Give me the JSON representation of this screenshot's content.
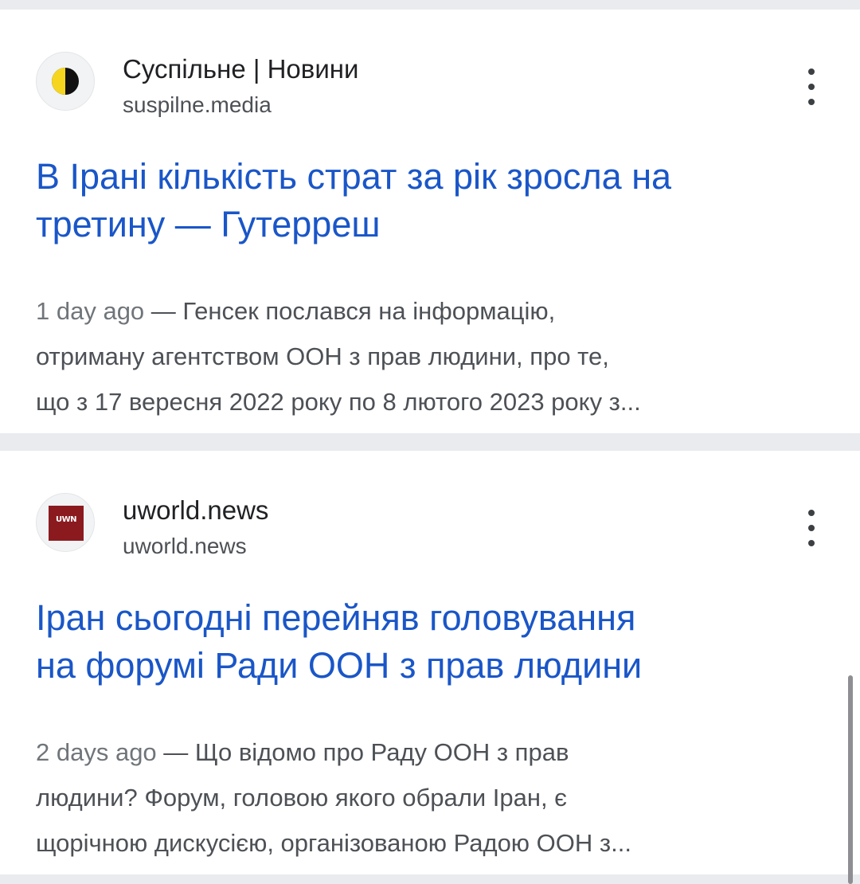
{
  "results": [
    {
      "site_name": "Суспільне | Новини",
      "site_url": "suspilne.media",
      "favicon_icon": "suspilne-logo-icon",
      "title_lines": [
        "В Ірані кількість страт за рік зросла на",
        "третину — Гутерреш"
      ],
      "date": "1 day ago",
      "snippet_lines": [
        " — Генсек послався на інформацію,",
        "отриману агентством ООН з прав людини, про те,",
        "що з 17 вересня 2022 року по 8 лютого 2023 року з..."
      ]
    },
    {
      "site_name": "uworld.news",
      "site_url": "uworld.news",
      "favicon_icon": "uwn-logo-icon",
      "favicon_text": "UWN",
      "title_lines": [
        "Іран сьогодні перейняв головування",
        "на форумі Ради ООН з прав людини"
      ],
      "date": "2 days ago",
      "snippet_lines": [
        " — Що відомо про Раду ООН з прав",
        "людини? Форум, головою якого обрали Іран, є",
        "щорічною дискусією, організованою Радою ООН з..."
      ]
    }
  ],
  "colors": {
    "title_link": "#1a56c8",
    "snippet_text": "#4d5156",
    "page_background": "#e9ebee",
    "card_background": "#ffffff"
  },
  "icons": {
    "more": "more-vert-icon"
  }
}
